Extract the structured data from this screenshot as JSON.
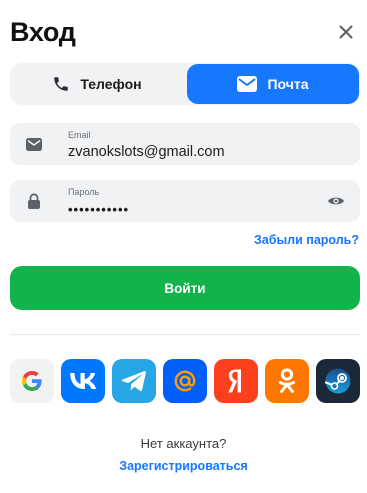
{
  "header": {
    "title": "Вход",
    "close_icon": "close-icon"
  },
  "tabs": [
    {
      "label": "Телефон",
      "icon": "phone-icon",
      "active": false
    },
    {
      "label": "Почта",
      "icon": "mail-icon",
      "active": true
    }
  ],
  "email_field": {
    "label": "Email",
    "value": "zvanokslots@gmail.com",
    "icon": "mail-icon"
  },
  "password_field": {
    "label": "Пароль",
    "value": "•••••••••••",
    "icon": "lock-icon",
    "toggle_icon": "eye-icon"
  },
  "forgot_link": "Забыли пароль?",
  "login_button": "Войти",
  "social": [
    {
      "name": "google",
      "icon": "google-icon",
      "color": "#f1f2f4"
    },
    {
      "name": "vk",
      "icon": "vk-icon",
      "color": "#0077ff"
    },
    {
      "name": "telegram",
      "icon": "telegram-icon",
      "color": "#27a6e5"
    },
    {
      "name": "mail-ru",
      "icon": "at-icon",
      "color": "#005ff9"
    },
    {
      "name": "yandex",
      "icon": "yandex-icon",
      "color": "#fc3f1d"
    },
    {
      "name": "odnoklassniki",
      "icon": "ok-icon",
      "color": "#ff7700"
    },
    {
      "name": "steam",
      "icon": "steam-icon",
      "color": "#1b2838"
    }
  ],
  "footer": {
    "no_account": "Нет аккаунта?",
    "register_link": "Зарегистрироваться"
  },
  "colors": {
    "accent": "#1677ff",
    "login": "#12b34a",
    "field_bg": "#f1f2f4"
  }
}
